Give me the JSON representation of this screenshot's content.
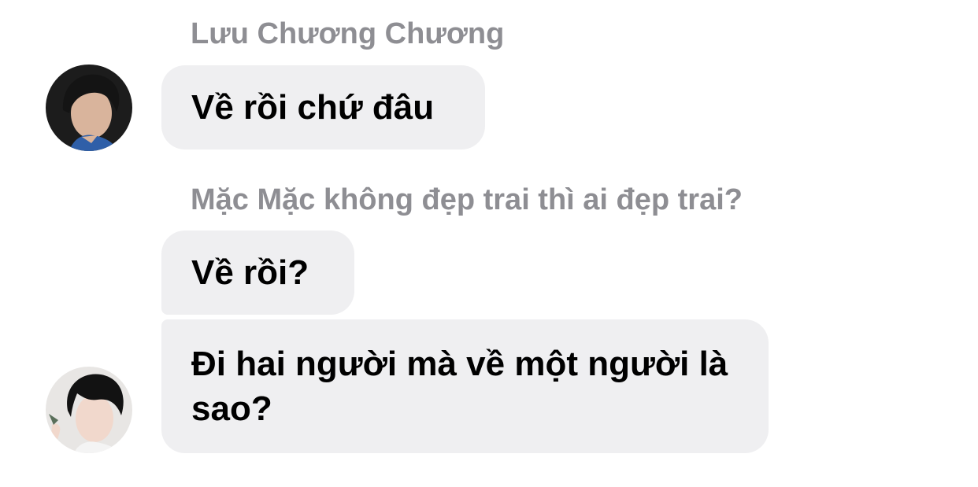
{
  "conversation": {
    "groups": [
      {
        "sender": "Lưu Chương Chương",
        "avatar_icon": "avatar-dark-hair-portrait",
        "messages": [
          "Về rồi chứ đâu"
        ]
      },
      {
        "sender": "Mặc Mặc không đẹp trai thì ai đẹp trai?",
        "avatar_icon": "avatar-black-hair-light-portrait",
        "messages": [
          "Về rồi?",
          "Đi hai người mà về một người là sao?"
        ]
      }
    ]
  },
  "colors": {
    "bubble_bg": "#efeff1",
    "sender_text": "#8e8e93",
    "message_text": "#000000",
    "background": "#ffffff"
  }
}
